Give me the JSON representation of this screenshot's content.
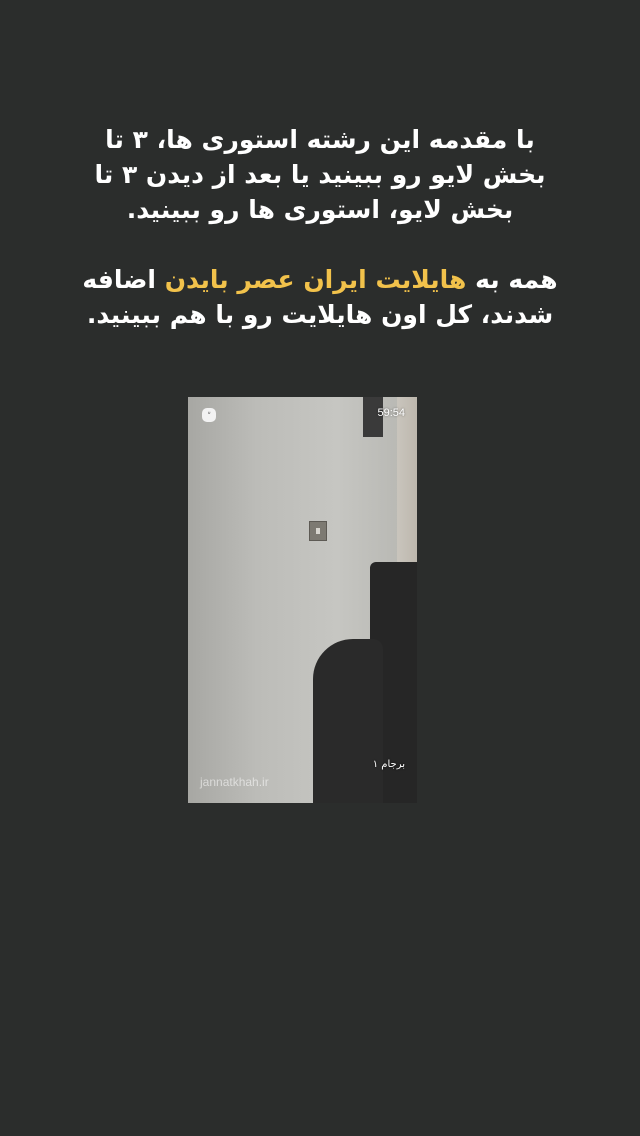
{
  "story": {
    "paragraph1": "با مقدمه این رشته استوری ها، ۳ تا بخش لایو رو ببینید یا بعد از دیدن ۳ تا بخش لایو، استوری ها رو ببینید.",
    "paragraph2": {
      "before": "همه به",
      "highlight": "هایلایت ایران عصر بایدن",
      "after": "اضافه شدند، کل اون هایلایت رو با هم ببینید."
    },
    "highlight_color": "#f2c24b"
  },
  "video": {
    "timer": "59:54",
    "caption_tag": "برجام ۱",
    "watermark": "jannatkhah.ir",
    "badge_icon": "camera-icon",
    "badge_glyph": "ᐡ"
  }
}
